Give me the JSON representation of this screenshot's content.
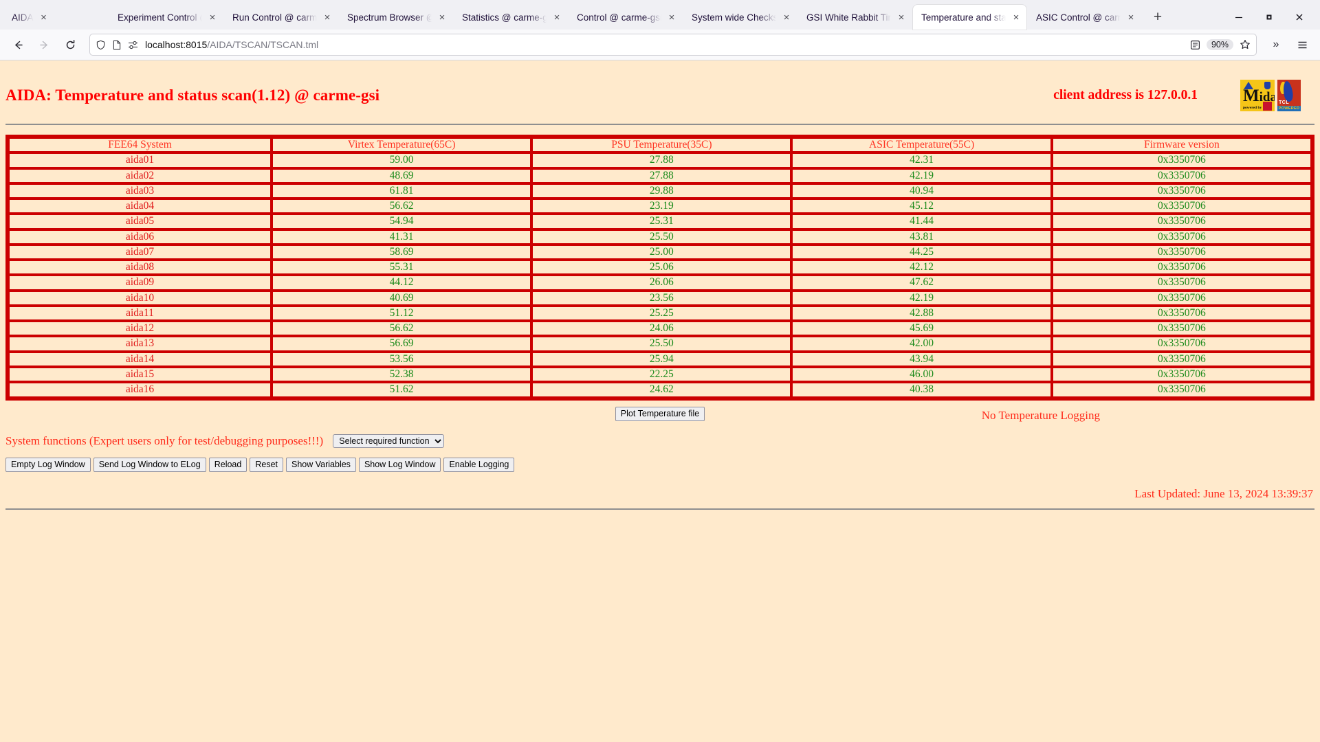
{
  "browser": {
    "tabs": [
      {
        "label": "AIDA",
        "active": false
      },
      {
        "label": "Experiment Control @ carme-gsi",
        "active": false
      },
      {
        "label": "Run Control @ carme-gsi",
        "active": false
      },
      {
        "label": "Spectrum Browser @ carme-gsi",
        "active": false
      },
      {
        "label": "Statistics @ carme-gsi",
        "active": false
      },
      {
        "label": "Control @ carme-gsi",
        "active": false
      },
      {
        "label": "System wide Checks (carme-gsi)",
        "active": false
      },
      {
        "label": "GSI White Rabbit Time",
        "active": false
      },
      {
        "label": "Temperature and status scan",
        "active": true
      },
      {
        "label": "ASIC Control @ carme-gsi",
        "active": false
      }
    ],
    "close_glyph": "×",
    "newtab_glyph": "+",
    "window_minimize": "–",
    "window_maximize": "□",
    "window_close": "✕",
    "url_host": "localhost:8015",
    "url_path": "/AIDA/TSCAN/TSCAN.tml",
    "zoom_level": "90%",
    "overflow_glyph": "»"
  },
  "header": {
    "title": "AIDA: Temperature and status scan(1.12) @ carme-gsi",
    "client_address": "client address is 127.0.0.1",
    "midas_word_first": "M",
    "midas_word_rest": "idas",
    "midas_powered": "powered by",
    "tcl_text": "TCL",
    "tcl_powered": "POWERED"
  },
  "table": {
    "columns": [
      "FEE64 System",
      "Virtex Temperature(65C)",
      "PSU Temperature(35C)",
      "ASIC Temperature(55C)",
      "Firmware version"
    ],
    "rows": [
      {
        "system": "aida01",
        "virtex": "59.00",
        "psu": "27.88",
        "asic": "42.31",
        "firmware": "0x3350706"
      },
      {
        "system": "aida02",
        "virtex": "48.69",
        "psu": "27.88",
        "asic": "42.19",
        "firmware": "0x3350706"
      },
      {
        "system": "aida03",
        "virtex": "61.81",
        "psu": "29.88",
        "asic": "40.94",
        "firmware": "0x3350706"
      },
      {
        "system": "aida04",
        "virtex": "56.62",
        "psu": "23.19",
        "asic": "45.12",
        "firmware": "0x3350706"
      },
      {
        "system": "aida05",
        "virtex": "54.94",
        "psu": "25.31",
        "asic": "41.44",
        "firmware": "0x3350706"
      },
      {
        "system": "aida06",
        "virtex": "41.31",
        "psu": "25.50",
        "asic": "43.81",
        "firmware": "0x3350706"
      },
      {
        "system": "aida07",
        "virtex": "58.69",
        "psu": "25.00",
        "asic": "44.25",
        "firmware": "0x3350706"
      },
      {
        "system": "aida08",
        "virtex": "55.31",
        "psu": "25.06",
        "asic": "42.12",
        "firmware": "0x3350706"
      },
      {
        "system": "aida09",
        "virtex": "44.12",
        "psu": "26.06",
        "asic": "47.62",
        "firmware": "0x3350706"
      },
      {
        "system": "aida10",
        "virtex": "40.69",
        "psu": "23.56",
        "asic": "42.19",
        "firmware": "0x3350706"
      },
      {
        "system": "aida11",
        "virtex": "51.12",
        "psu": "25.25",
        "asic": "42.88",
        "firmware": "0x3350706"
      },
      {
        "system": "aida12",
        "virtex": "56.62",
        "psu": "24.06",
        "asic": "45.69",
        "firmware": "0x3350706"
      },
      {
        "system": "aida13",
        "virtex": "56.69",
        "psu": "25.50",
        "asic": "42.00",
        "firmware": "0x3350706"
      },
      {
        "system": "aida14",
        "virtex": "53.56",
        "psu": "25.94",
        "asic": "43.94",
        "firmware": "0x3350706"
      },
      {
        "system": "aida15",
        "virtex": "52.38",
        "psu": "22.25",
        "asic": "46.00",
        "firmware": "0x3350706"
      },
      {
        "system": "aida16",
        "virtex": "51.62",
        "psu": "24.62",
        "asic": "40.38",
        "firmware": "0x3350706"
      }
    ]
  },
  "controls": {
    "plot_button": "Plot Temperature file",
    "logging_status": "No Temperature Logging",
    "system_functions_label": "System functions (Expert users only for test/debugging purposes!!!)",
    "function_select_value": "Select required function",
    "buttons": [
      "Empty Log Window",
      "Send Log Window to ELog",
      "Reload",
      "Reset",
      "Show Variables",
      "Show Log Window",
      "Enable Logging"
    ]
  },
  "footer": {
    "last_updated": "Last Updated: June 13, 2024 13:39:37"
  },
  "colors": {
    "page_background": "#ffeacc",
    "title_red": "#ff0000",
    "table_border_red": "#cc0000",
    "value_green": "#1a8a1a",
    "label_red": "#ff3322"
  }
}
